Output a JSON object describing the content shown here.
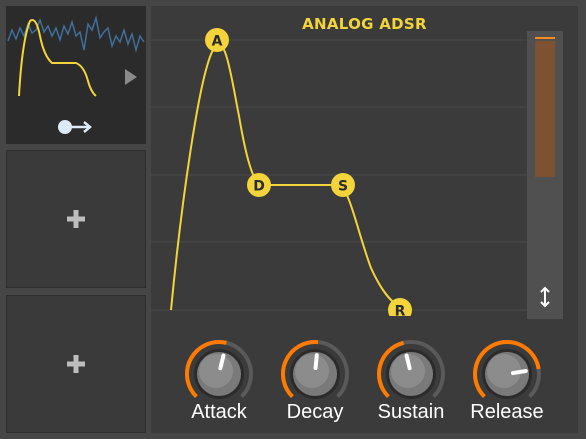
{
  "panel": {
    "title": "ANALOG ADSR"
  },
  "sidebar": {
    "preview": {
      "play_icon": "play-triangle-icon",
      "routing_icon": "modulation-routing-icon"
    },
    "empty_slots": [
      {
        "icon": "add-plus-icon"
      },
      {
        "icon": "add-plus-icon"
      }
    ]
  },
  "envelope": {
    "points": [
      {
        "label": "A",
        "name": "attack"
      },
      {
        "label": "D",
        "name": "decay"
      },
      {
        "label": "S",
        "name": "sustain"
      },
      {
        "label": "R",
        "name": "release"
      }
    ]
  },
  "knobs": [
    {
      "label": "Attack",
      "value": 0.55
    },
    {
      "label": "Decay",
      "value": 0.52
    },
    {
      "label": "Sustain",
      "value": 0.45
    },
    {
      "label": "Release",
      "value": 0.8
    }
  ],
  "output_meter": {
    "level": 0.48
  },
  "colors": {
    "accent_yellow": "#f3d43b",
    "accent_orange": "#ff7a00",
    "meter_fill": "#7d5233",
    "background": "#3b3b3b"
  }
}
